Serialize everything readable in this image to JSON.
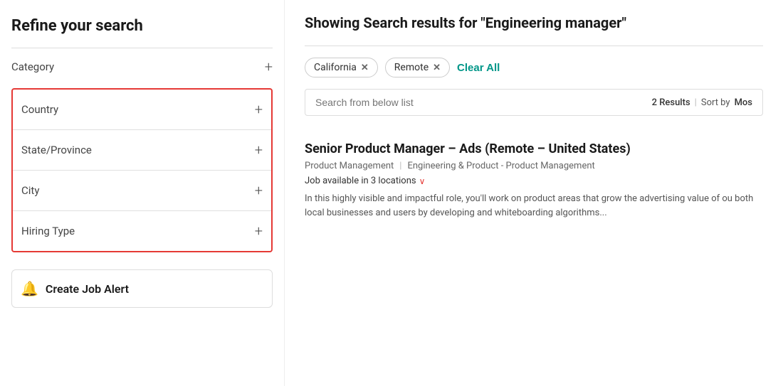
{
  "sidebar": {
    "title": "Refine your search",
    "category_label": "Category",
    "filter_sections": [
      {
        "label": "Country",
        "id": "country"
      },
      {
        "label": "State/Province",
        "id": "state-province"
      },
      {
        "label": "City",
        "id": "city"
      },
      {
        "label": "Hiring Type",
        "id": "hiring-type"
      }
    ],
    "create_alert_label": "Create Job Alert"
  },
  "main": {
    "heading_prefix": "Showing Search results for ",
    "heading_query": "\"Engineering manager\"",
    "active_filters": [
      {
        "label": "California",
        "id": "california"
      },
      {
        "label": "Remote",
        "id": "remote"
      }
    ],
    "clear_all_label": "Clear All",
    "search_placeholder": "Search from below list",
    "results_count": "2 Results",
    "sort_label": "Sort by",
    "sort_value": "Mos",
    "job": {
      "title": "Senior Product Manager – Ads (Remote – United States)",
      "meta1": "Product Management",
      "meta2": "Engineering & Product - Product Management",
      "locations_text": "Job available in 3 locations",
      "description": "In this highly visible and impactful role, you'll work on product areas that grow the advertising value of ou both local businesses and users by developing and whiteboarding algorithms..."
    }
  }
}
